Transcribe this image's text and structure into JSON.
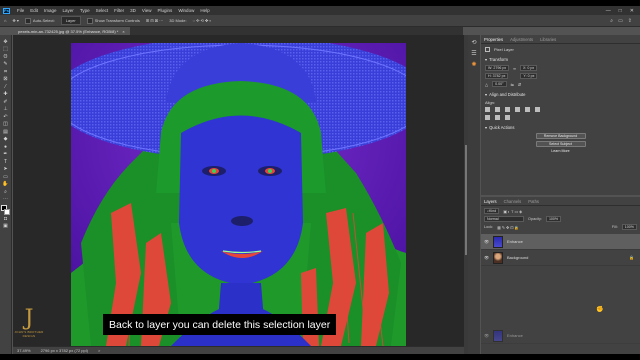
{
  "menubar": {
    "logo": "Ps",
    "items": [
      "File",
      "Edit",
      "Image",
      "Layer",
      "Type",
      "Select",
      "Filter",
      "3D",
      "View",
      "Plugins",
      "Window",
      "Help"
    ],
    "window_controls": [
      "—",
      "□",
      "✕"
    ]
  },
  "options_bar": {
    "auto_select_label": "Auto-Select:",
    "auto_select_value": "Layer",
    "transform_controls_label": "Show Transform Controls",
    "mode_label": "3D Mode:"
  },
  "document": {
    "tab_title": "pexels-min-an-732425.jpg @ 37.5% (Enhance, RGB/8) *",
    "close_glyph": "×"
  },
  "status": {
    "zoom": "37.49%",
    "doc_size": "2796 px x 3782 px (72 ppi)",
    "arrow": ">"
  },
  "properties_panel": {
    "tabs": [
      "Properties",
      "Adjustments",
      "Libraries"
    ],
    "active_tab": 0,
    "layer_kind": "Pixel Layer",
    "transform_title": "Transform",
    "width": "W: 2796 px",
    "height": "H: 3782 px",
    "x": "X: 0 px",
    "y": "Y: 0 px",
    "angle": "0.00°",
    "align_title": "Align and Distribute",
    "align_label": "Align:",
    "quick_actions_title": "Quick Actions",
    "buttons": [
      "Remove Background",
      "Select Subject",
      "Learn More"
    ]
  },
  "layers_panel": {
    "tabs": [
      "Layers",
      "Channels",
      "Paths"
    ],
    "active_tab": 0,
    "filter_label": "Kind",
    "blend_mode": "Normal",
    "opacity_label": "Opacity:",
    "opacity_value": "100%",
    "lock_label": "Lock:",
    "fill_label": "Fill:",
    "fill_value": "100%",
    "layers": [
      {
        "name": "Enhance",
        "selected": true,
        "visible": true
      },
      {
        "name": "Background",
        "selected": false,
        "visible": true,
        "locked": true
      }
    ],
    "dragging_layer": "Enhance"
  },
  "subtitle": "Back to layer you can delete this selection layer",
  "watermark": {
    "mark": "J",
    "line1": "JOHN'S BROTHER",
    "line2": "DESIGN"
  },
  "colors": {
    "app_bg": "#535353",
    "panel_bg": "#424242",
    "menubar_bg": "#323232",
    "image_purple": "#6a1fb4",
    "image_blue": "#2f34d2",
    "hair_green": "#1f9a2a",
    "hair_red": "#e8453a",
    "accent_gold": "#c59a3f"
  }
}
